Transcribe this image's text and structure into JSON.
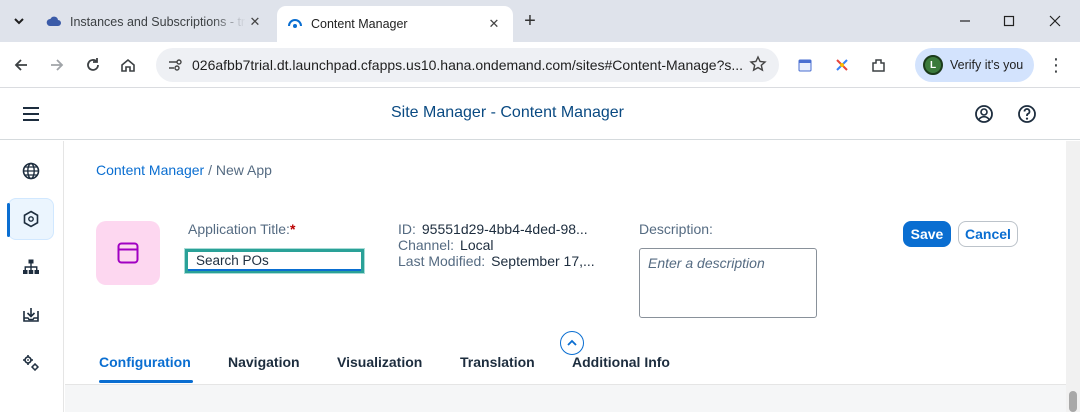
{
  "browser": {
    "tabs": [
      {
        "title": "Instances and Subscriptions - tr",
        "icon": "cloud-icon",
        "active": false
      },
      {
        "title": "Content Manager",
        "icon": "sap-site-icon",
        "active": true
      }
    ],
    "url": "026afbb7trial.dt.launchpad.cfapps.us10.hana.ondemand.com/sites#Content-Manage?s...",
    "profile_label": "Verify it's you",
    "profile_initial": "L"
  },
  "shell": {
    "title": "Site Manager - Content Manager"
  },
  "breadcrumb": {
    "parent": "Content Manager",
    "separator": " / ",
    "current": "New App"
  },
  "form": {
    "app_title_label": "Application Title:",
    "required_marker": "*",
    "app_title_value": "Search POs",
    "id_label": "ID:",
    "id_value": "95551d29-4bb4-4ded-98...",
    "channel_label": "Channel:",
    "channel_value": "Local",
    "modified_label": "Last Modified:",
    "modified_value": "September 17,...",
    "description_label": "Description:",
    "description_placeholder": "Enter a description"
  },
  "actions": {
    "save_label": "Save",
    "cancel_label": "Cancel"
  },
  "tabs": [
    {
      "label": "Configuration",
      "active": true
    },
    {
      "label": "Navigation",
      "active": false
    },
    {
      "label": "Visualization",
      "active": false
    },
    {
      "label": "Translation",
      "active": false
    },
    {
      "label": "Additional Info",
      "active": false
    }
  ],
  "colors": {
    "accent": "#0a6ed1",
    "title_blue": "#0a4a82",
    "app_icon_bg": "#fdd7f0",
    "focus_highlight": "#2aa198"
  }
}
